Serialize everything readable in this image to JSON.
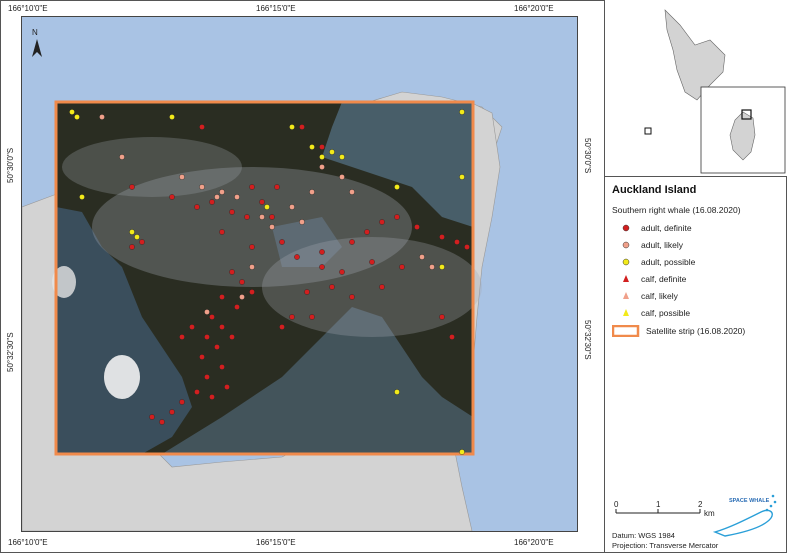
{
  "map": {
    "top_ticks": [
      "166°10'0\"E",
      "166°15'0\"E",
      "166°20'0\"E"
    ],
    "bottom_ticks": [
      "166°10'0\"E",
      "166°15'0\"E",
      "166°20'0\"E"
    ],
    "left_ticks": [
      "50°30'0\"S",
      "50°32'30\"S"
    ],
    "right_ticks": [
      "50°30'0\"S",
      "50°32'30\"S"
    ],
    "north_label": "N",
    "colors": {
      "sea": "#a9c3e4",
      "land": "#d3d3d3",
      "strip_border": "#f08a4b",
      "imagery": "#2a2d22"
    }
  },
  "legend": {
    "title": "Auckland Island",
    "subtitle": "Southern right whale (16.08.2020)",
    "items": [
      {
        "label": "adult, definite",
        "shape": "circle",
        "color": "#d21f1f"
      },
      {
        "label": "adult, likely",
        "shape": "circle",
        "color": "#f0a08a"
      },
      {
        "label": "adult, possible",
        "shape": "circle",
        "color": "#f2ea1a"
      },
      {
        "label": "calf, definite",
        "shape": "triangle",
        "color": "#d21f1f"
      },
      {
        "label": "calf, likely",
        "shape": "triangle",
        "color": "#f0a08a"
      },
      {
        "label": "calf, possible",
        "shape": "triangle",
        "color": "#f2ea1a"
      },
      {
        "label": "Satellite strip (16.08.2020)",
        "shape": "rect",
        "color": "#f08a4b"
      }
    ]
  },
  "scale": {
    "ticks": [
      "0",
      "1",
      "2"
    ],
    "unit": "km"
  },
  "footer": {
    "datum": "Datum: WGS 1984",
    "projection": "Projection: Transverse Mercator"
  },
  "logo": {
    "text": "SPACE WHALE"
  }
}
